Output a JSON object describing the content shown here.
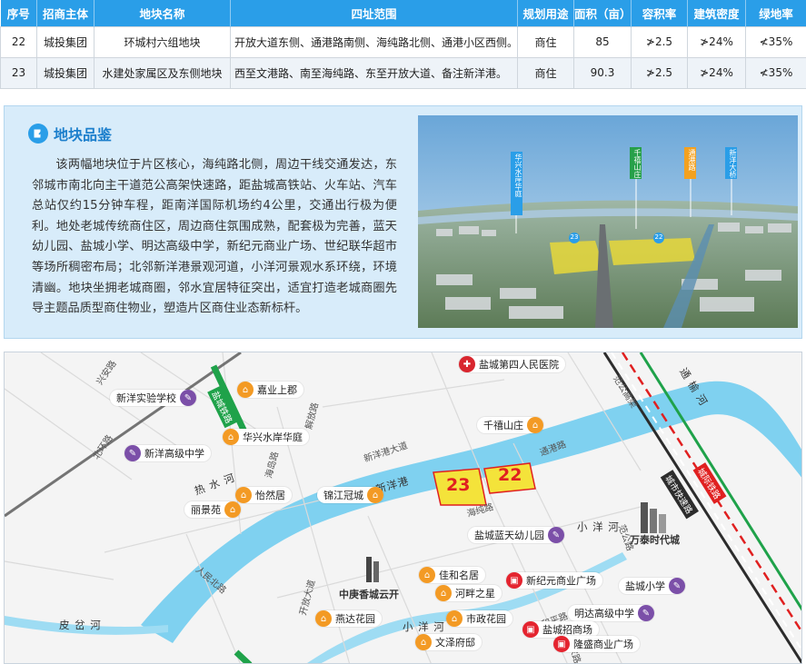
{
  "table": {
    "headers": [
      "序号",
      "招商主体",
      "地块名称",
      "四址范围",
      "规划用途",
      "面积（亩）",
      "容积率",
      "建筑密度",
      "绿地率"
    ],
    "rows": [
      [
        "22",
        "城投集团",
        "环城村六组地块",
        "开放大道东侧、通港路南侧、海纯路北侧、通港小区西侧。",
        "商住",
        "85",
        "≯2.5",
        "≯24%",
        "≮35%"
      ],
      [
        "23",
        "城投集团",
        "水建处家属区及东侧地块",
        "西至文港路、南至海纯路、东至开放大道、备注新洋港。",
        "商住",
        "90.3",
        "≯2.5",
        "≯24%",
        "≮35%"
      ]
    ]
  },
  "info": {
    "title": "地块品鉴",
    "body": "该两幅地块位于片区核心，海纯路北侧，周边干线交通发达，东邻城市南北向主干道范公高架快速路，距盐城高铁站、火车站、汽车总站仅约15分钟车程，距南洋国际机场约4公里，交通出行极为便利。地处老城传统商住区，周边商住氛围成熟，配套极为完善，蓝天幼儿园、盐城小学、明达高级中学，新纪元商业广场、世纪联华超市等场所稠密布局；北邻新洋港景观河道，小洋河景观水系环绕，环境清幽。地块坐拥老城商圈，邻水宜居特征突出，适宜打造老城商圈先导主题品质型商住物业，塑造片区商住业态新标杆。"
  },
  "aerial": {
    "tags": [
      "华兴水岸华庭",
      "千禧山庄",
      "通港路",
      "新洋大桥"
    ],
    "plots": [
      "23",
      "22"
    ]
  },
  "map": {
    "plots": [
      "23",
      "22"
    ],
    "pois": {
      "hospital_1": "盐城第四人民医院",
      "jiaye": "嘉业上郡",
      "xinyang_exp": "新洋实验学校",
      "huaxing": "华兴水岸华庭",
      "xinyang_hs": "新洋高级中学",
      "qianxi": "千禧山庄",
      "jinjiang": "锦江冠城",
      "yiran": "怡然居",
      "lijing": "丽景苑",
      "lantian": "盐城蓝天幼儿园",
      "jiahe": "佳和名居",
      "xinjiyuan": "新纪元商业广场",
      "yc_primary": "盐城小学",
      "hepan": "河畔之星",
      "mingda": "明达高级中学",
      "yanda": "燕达花园",
      "shizheng": "市政花园",
      "yc_mall": "盐城招商场",
      "wenze": "文泽府邸",
      "longsheng": "隆盛商业广场"
    },
    "landmarks": {
      "wantai": "万泰时代城",
      "zhongjun": "中庚香城云开"
    },
    "water": {
      "xinyanggang": "新洋港",
      "reshui": "热 水 河",
      "xiaoyang_1": "小 洋 河",
      "xiaoyang_2": "小 洋 河",
      "pichahe": "皮 岔 河",
      "tongyuhe": "通 榆 河"
    },
    "roads": {
      "xinyang_ave": "新洋港大道",
      "tonggang": "通港路",
      "haichun": "海纯路",
      "beihuan": "北环路",
      "xinghuo": "兴安路",
      "haidao": "海岛路",
      "jiefang": "解放路",
      "kaifang": "开放大道",
      "renmin": "人民北路",
      "heping": "和平路",
      "hanjia": "韩家路",
      "fanggong": "范公路",
      "fan_high": "范公高架"
    },
    "metro": {
      "line1": "城市快速路",
      "rail": "城际铁路",
      "rail2": "盐城铁路"
    }
  }
}
